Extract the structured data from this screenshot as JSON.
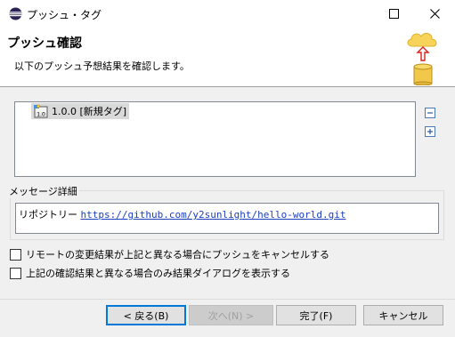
{
  "window": {
    "title": "プッシュ・タグ"
  },
  "banner": {
    "title": "プッシュ確認",
    "description": "以下のプッシュ予想結果を確認します。"
  },
  "tree": {
    "items": [
      {
        "label": "1.0.0 [新規タグ]",
        "icon": "tag-icon"
      }
    ]
  },
  "side_actions": {
    "collapse": "collapse-all-icon",
    "expand": "expand-all-icon"
  },
  "message": {
    "group_label": "メッセージ詳細",
    "prefix": "リポジトリー",
    "repo_url": "https://github.com/y2sunlight/hello-world.git"
  },
  "options": [
    {
      "label": "リモートの変更結果が上記と異なる場合にプッシュをキャンセルする",
      "checked": false
    },
    {
      "label": "上記の確認結果と異なる場合のみ結果ダイアログを表示する",
      "checked": false
    }
  ],
  "buttons": {
    "back": "< 戻る(B)",
    "next": "次へ(N) >",
    "finish": "完了(F)",
    "cancel": "キャンセル"
  },
  "colors": {
    "link": "#1a3fc0",
    "default_button_border": "#0078d7",
    "dialog_bg": "#f0f0f0"
  }
}
